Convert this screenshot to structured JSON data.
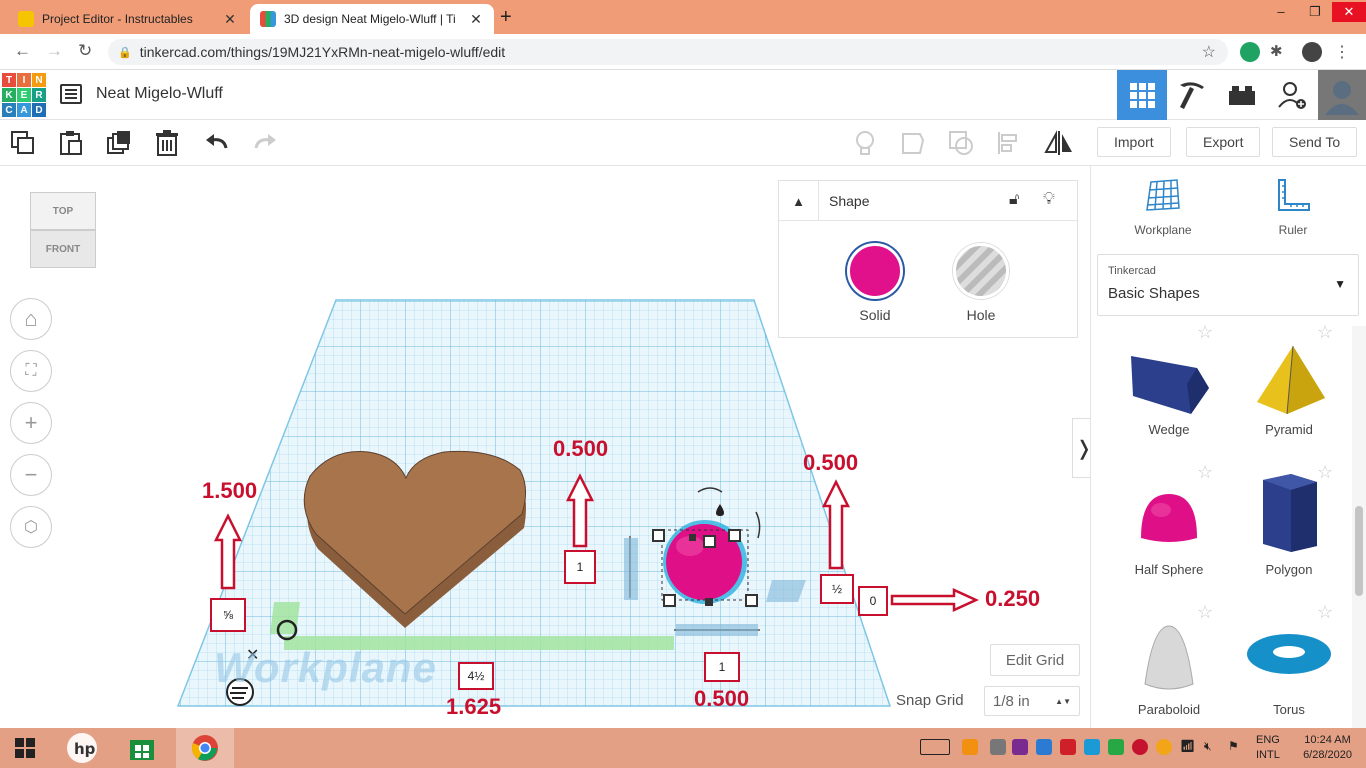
{
  "browser": {
    "tabs": [
      {
        "title": "Project Editor - Instructables",
        "active": false
      },
      {
        "title": "3D design Neat Migelo-Wluff | Ti",
        "active": true
      }
    ],
    "new_tab": "+",
    "url": "tinkercad.com/things/19MJ21YxRMn-neat-migelo-wluff/edit"
  },
  "app": {
    "logo_letters": [
      "T",
      "I",
      "N",
      "K",
      "E",
      "R",
      "C",
      "A",
      "D"
    ],
    "project_name": "Neat Migelo-Wluff",
    "toolbar": {
      "import": "Import",
      "export": "Export",
      "send_to": "Send To"
    }
  },
  "viewcube": {
    "top": "TOP",
    "front": "FRONT"
  },
  "shape_panel": {
    "title": "Shape",
    "solid": "Solid",
    "hole": "Hole",
    "solid_color": "#e0118a"
  },
  "workplane": {
    "label": "Workplane",
    "edit_grid": "Edit Grid",
    "snap_grid_label": "Snap Grid",
    "snap_grid_value": "1/8 in"
  },
  "dimension_boxes": {
    "heart_height": "⅝",
    "heart_length": "4½",
    "sphere_height": "1",
    "sphere_width": "1",
    "sphere_depth": "½",
    "elevation": "0"
  },
  "annotations": {
    "heart_height": "1.500",
    "heart_length": "1.625",
    "sphere_height": "0.500",
    "sphere_width": "0.500",
    "sphere_depth": "0.500",
    "elevation": "0.250"
  },
  "sidebar": {
    "workplane": "Workplane",
    "ruler": "Ruler",
    "library_source": "Tinkercad",
    "library_name": "Basic Shapes",
    "shapes": [
      "Wedge",
      "Pyramid",
      "Half Sphere",
      "Polygon",
      "Paraboloid",
      "Torus"
    ]
  },
  "taskbar": {
    "lang": "ENG",
    "lang2": "INTL",
    "time": "10:24 AM",
    "date": "6/28/2020"
  }
}
